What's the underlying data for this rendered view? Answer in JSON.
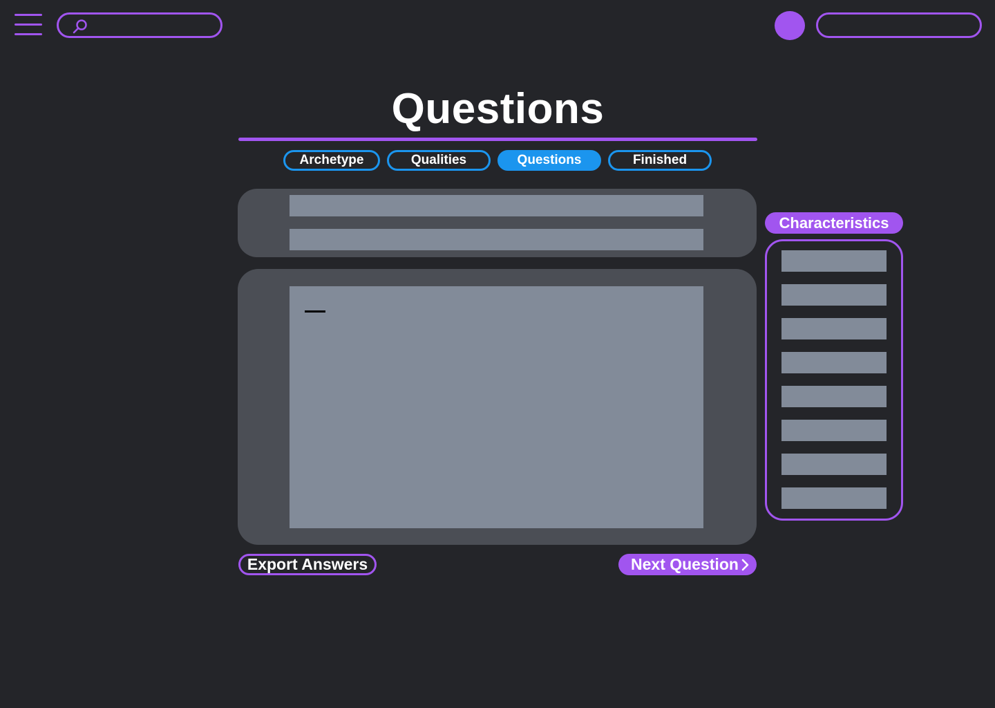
{
  "header": {
    "menu_icon": "hamburger-menu-icon",
    "search": {
      "icon": "search-icon",
      "placeholder": "",
      "value": ""
    },
    "avatar_color": "#a155ef"
  },
  "page": {
    "title": "Questions"
  },
  "steps": [
    {
      "label": "Archetype",
      "active": false
    },
    {
      "label": "Qualities",
      "active": false
    },
    {
      "label": "Questions",
      "active": true
    },
    {
      "label": "Finished",
      "active": false
    }
  ],
  "actions": {
    "export_label": "Export Answers",
    "next_label": "Next Question",
    "next_icon": "chevron-right-icon"
  },
  "sidebar": {
    "title": "Characteristics",
    "items": [
      "",
      "",
      "",
      "",
      "",
      "",
      "",
      ""
    ]
  },
  "colors": {
    "background": "#242529",
    "accent_purple": "#a155ef",
    "accent_blue": "#1b95ee",
    "panel": "#4b4e55",
    "placeholder_block": "#828b99"
  }
}
